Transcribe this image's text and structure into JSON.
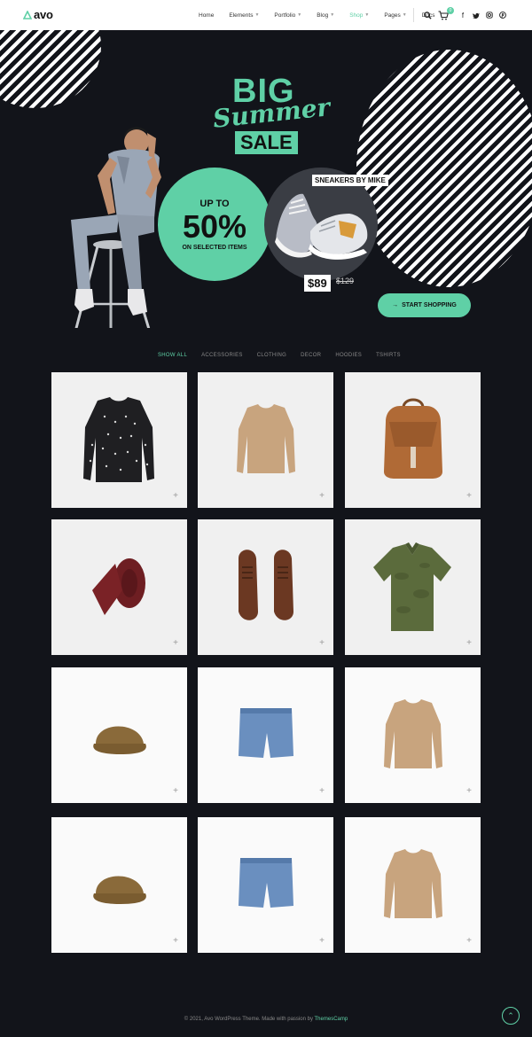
{
  "brand": {
    "name": "avo"
  },
  "nav": {
    "items": [
      {
        "label": "Home",
        "caret": false
      },
      {
        "label": "Elements",
        "caret": true
      },
      {
        "label": "Portfolio",
        "caret": true
      },
      {
        "label": "Blog",
        "caret": true
      },
      {
        "label": "Shop",
        "caret": true,
        "active": true
      },
      {
        "label": "Pages",
        "caret": true
      },
      {
        "label": "Docs",
        "caret": false
      }
    ],
    "cart_count": "0"
  },
  "hero": {
    "line1": "BIG",
    "line2": "Summer",
    "line3": "SALE",
    "discount_prefix": "UP TO",
    "discount": "50%",
    "discount_suffix": "ON SELECTED ITEMS",
    "product_tag": "SNEAKERS BY MIKE",
    "price": "$89",
    "old_price": "$129",
    "cta": "START SHOPPING"
  },
  "filters": [
    "SHOW ALL",
    "ACCESSORIES",
    "CLOTHING",
    "DECOR",
    "HOODIES",
    "TSHIRTS"
  ],
  "products": [
    {
      "icon": "sweater-dark-icon"
    },
    {
      "icon": "sweater-tan-icon"
    },
    {
      "icon": "backpack-icon"
    },
    {
      "icon": "tie-icon"
    },
    {
      "icon": "shoes-icon"
    },
    {
      "icon": "polo-icon"
    },
    {
      "icon": "cap-icon"
    },
    {
      "icon": "shorts-icon"
    },
    {
      "icon": "sweater-tan-icon"
    },
    {
      "icon": "cap-icon"
    },
    {
      "icon": "shorts-icon"
    },
    {
      "icon": "sweater-tan-icon"
    }
  ],
  "footer": {
    "text": "© 2021, Avo WordPress Theme. Made with passion by",
    "credit": "ThemesCamp"
  },
  "colors": {
    "accent": "#5fd0a6",
    "background": "#12141a"
  }
}
